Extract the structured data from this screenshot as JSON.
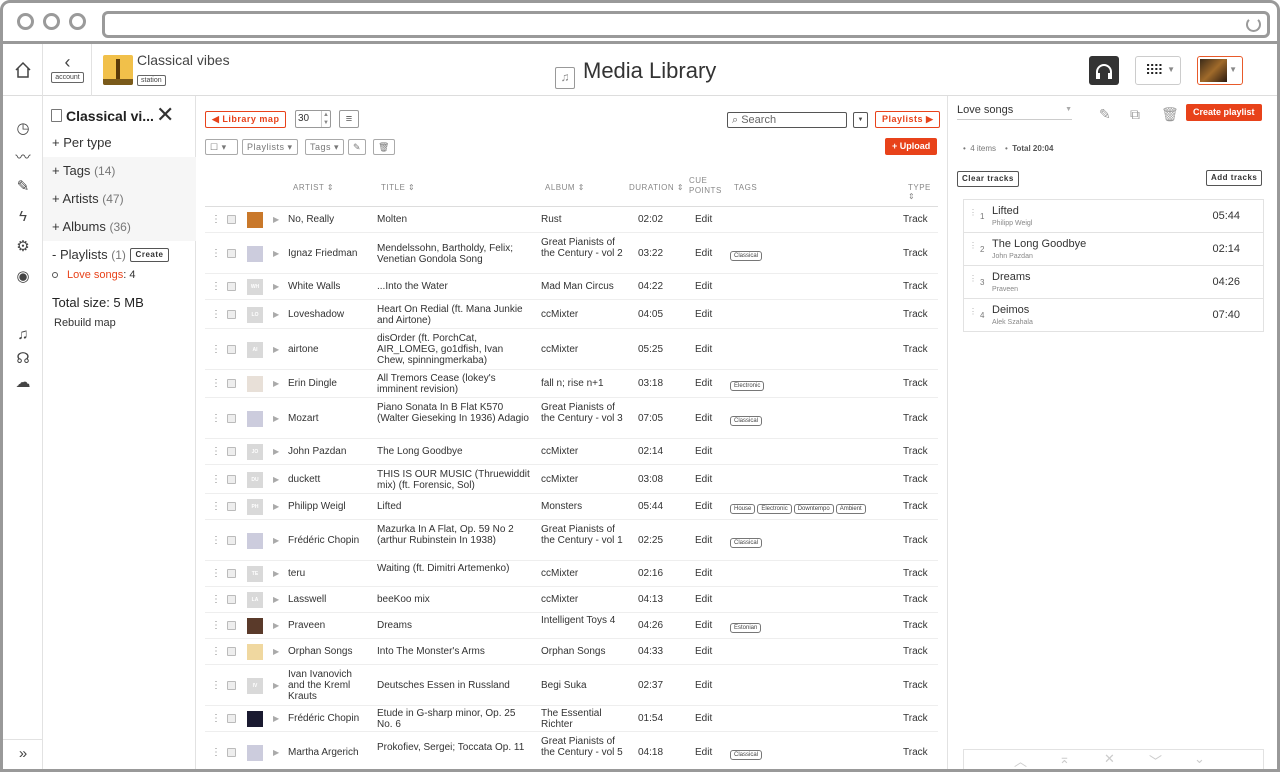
{
  "header": {
    "back_label": "account",
    "station_name": "Classical vibes",
    "station_tag": "station",
    "page_title": "Media Library"
  },
  "sidebar": {
    "title": "Classical vi...",
    "per_type": "+ Per type",
    "tags": "+ Tags",
    "tags_count": "(14)",
    "artists": "+ Artists",
    "artists_count": "(47)",
    "albums": "+ Albums",
    "albums_count": "(36)",
    "playlists": "- Playlists",
    "playlists_count": "(1)",
    "create_label": "Create",
    "playlist_item": "Love songs",
    "playlist_item_count": ": 4",
    "total_size": "Total size: 5 MB",
    "rebuild": "Rebuild map"
  },
  "toolbar": {
    "library_map": "◀ Library map",
    "per_page": "30",
    "search_placeholder": "Search",
    "playlists_btn": "Playlists ▶",
    "filter_playlists": "Playlists",
    "filter_tags": "Tags",
    "upload": "+ Upload"
  },
  "table": {
    "headers": {
      "artist": "ARTIST",
      "title": "TITLE",
      "album": "ALBUM",
      "duration": "DURATION",
      "cue1": "CUE",
      "cue2": "POINTS",
      "tags": "TAGS",
      "type": "TYPE"
    },
    "rows": [
      {
        "thumb": "",
        "artist": "No, Really",
        "title": "Molten",
        "album": "Rust",
        "duration": "02:02",
        "cue": "Edit",
        "tags": [],
        "type": "Track"
      },
      {
        "thumb": "",
        "artist": "Ignaz Friedman",
        "title": "Mendelssohn, Bartholdy, Felix; Venetian Gondola Song",
        "album": "Great Pianists of the Century - vol 2",
        "duration": "03:22",
        "cue": "Edit",
        "tags": [
          "Classical"
        ],
        "type": "Track"
      },
      {
        "thumb": "WH",
        "artist": "White Walls",
        "title": "...Into the Water",
        "album": "Mad Man Circus",
        "duration": "04:22",
        "cue": "Edit",
        "tags": [],
        "type": "Track"
      },
      {
        "thumb": "LO",
        "artist": "Loveshadow",
        "title": "Heart On Redial (ft. Mana Junkie and Airtone)",
        "album": "ccMixter",
        "duration": "04:05",
        "cue": "Edit",
        "tags": [],
        "type": "Track"
      },
      {
        "thumb": "AI",
        "artist": "airtone",
        "title": "disOrder (ft. PorchCat, AIR_LOMEG, go1dfish, Ivan Chew, spinningmerkaba)",
        "album": "ccMixter",
        "duration": "05:25",
        "cue": "Edit",
        "tags": [],
        "type": "Track"
      },
      {
        "thumb": "",
        "artist": "Erin Dingle",
        "title": "All Tremors Cease (lokey's imminent revision)",
        "album": "fall n; rise n+1",
        "duration": "03:18",
        "cue": "Edit",
        "tags": [
          "Electronic"
        ],
        "type": "Track"
      },
      {
        "thumb": "",
        "artist": "Mozart",
        "title": "Piano Sonata In B Flat K570 (Walter Gieseking In 1936) Adagio",
        "album": "Great Pianists of the Century - vol 3",
        "duration": "07:05",
        "cue": "Edit",
        "tags": [
          "Classical"
        ],
        "type": "Track"
      },
      {
        "thumb": "JO",
        "artist": "John Pazdan",
        "title": "The Long Goodbye",
        "album": "ccMixter",
        "duration": "02:14",
        "cue": "Edit",
        "tags": [],
        "type": "Track"
      },
      {
        "thumb": "DU",
        "artist": "duckett",
        "title": "THIS IS OUR MUSIC (Thruewiddit mix) (ft. Forensic, Sol)",
        "album": "ccMixter",
        "duration": "03:08",
        "cue": "Edit",
        "tags": [],
        "type": "Track"
      },
      {
        "thumb": "PH",
        "artist": "Philipp Weigl",
        "title": "Lifted",
        "album": "Monsters",
        "duration": "05:44",
        "cue": "Edit",
        "tags": [
          "House",
          "Electronic",
          "Downtempo",
          "Ambient"
        ],
        "type": "Track"
      },
      {
        "thumb": "",
        "artist": "Frédéric Chopin",
        "title": "Mazurka In A Flat, Op. 59 No 2 (arthur Rubinstein In 1938)",
        "album": "Great Pianists of the Century - vol 1",
        "duration": "02:25",
        "cue": "Edit",
        "tags": [
          "Classical"
        ],
        "type": "Track"
      },
      {
        "thumb": "TE",
        "artist": "teru",
        "title": "Waiting (ft. Dimitri Artemenko)",
        "album": "ccMixter",
        "duration": "02:16",
        "cue": "Edit",
        "tags": [],
        "type": "Track"
      },
      {
        "thumb": "LA",
        "artist": "Lasswell",
        "title": "beeKoo mix",
        "album": "ccMixter",
        "duration": "04:13",
        "cue": "Edit",
        "tags": [],
        "type": "Track"
      },
      {
        "thumb": "",
        "artist": "Praveen",
        "title": "Dreams",
        "album": "Intelligent Toys 4",
        "duration": "04:26",
        "cue": "Edit",
        "tags": [
          "Estonian"
        ],
        "type": "Track"
      },
      {
        "thumb": "",
        "artist": "Orphan Songs",
        "title": "Into The Monster's Arms",
        "album": "Orphan Songs",
        "duration": "04:33",
        "cue": "Edit",
        "tags": [],
        "type": "Track"
      },
      {
        "thumb": "IV",
        "artist": "Ivan Ivanovich and the Kreml Krauts",
        "title": "Deutsches Essen in Russland",
        "album": "Begi Suka",
        "duration": "02:37",
        "cue": "Edit",
        "tags": [],
        "type": "Track"
      },
      {
        "thumb": "",
        "artist": "Frédéric Chopin",
        "title": "Etude in G-sharp minor, Op. 25 No. 6",
        "album": "The Essential Richter",
        "duration": "01:54",
        "cue": "Edit",
        "tags": [],
        "type": "Track"
      },
      {
        "thumb": "",
        "artist": "Martha Argerich",
        "title": "Prokofiev, Sergei; Toccata Op. 11",
        "album": "Great Pianists of the Century - vol 5",
        "duration": "04:18",
        "cue": "Edit",
        "tags": [
          "Classical"
        ],
        "type": "Track"
      }
    ]
  },
  "playlist": {
    "selected": "Love songs",
    "create": "Create playlist",
    "items_count": "4 items",
    "total": "Total 20:04",
    "clear": "Clear tracks",
    "add": "Add tracks",
    "tracks": [
      {
        "idx": "1",
        "title": "Lifted",
        "artist": "Philipp Weigl",
        "duration": "05:44"
      },
      {
        "idx": "2",
        "title": "The Long Goodbye",
        "artist": "John Pazdan",
        "duration": "02:14"
      },
      {
        "idx": "3",
        "title": "Dreams",
        "artist": "Praveen",
        "duration": "04:26"
      },
      {
        "idx": "4",
        "title": "Deimos",
        "artist": "Alek Szahala",
        "duration": "07:40"
      }
    ]
  },
  "colors": {
    "accent": "#e8421a"
  }
}
